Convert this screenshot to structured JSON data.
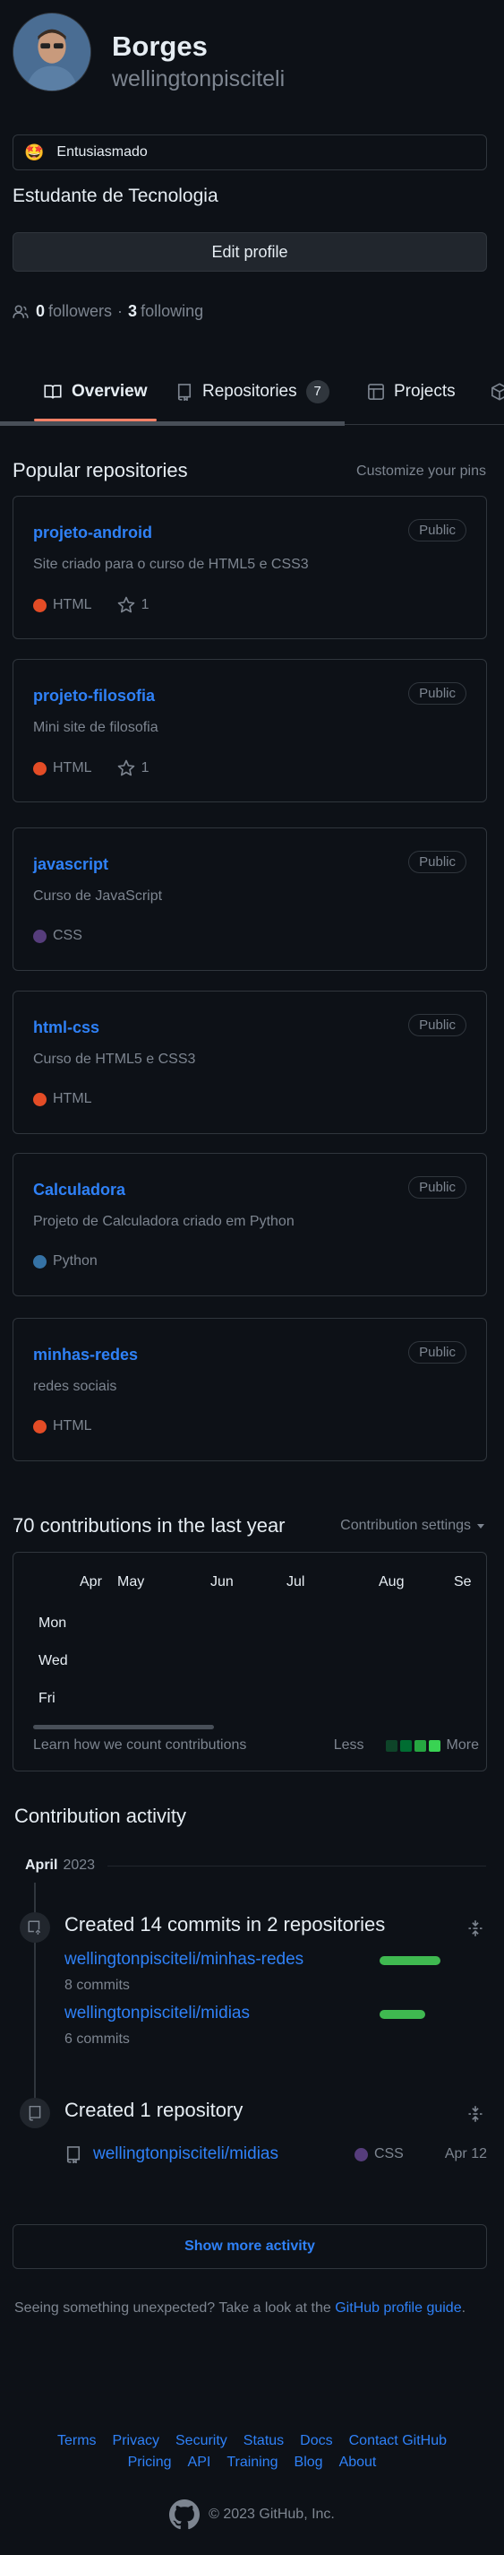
{
  "profile": {
    "name": "Borges",
    "login": "wellingtonpisciteli",
    "status_emoji": "🤩",
    "status_text": "Entusiasmado",
    "bio": "Estudante de Tecnologia",
    "edit_label": "Edit profile",
    "followers_count": "0",
    "followers_label": "followers",
    "separator": "·",
    "following_count": "3",
    "following_label": "following"
  },
  "tabs": {
    "overview": "Overview",
    "repositories": "Repositories",
    "repositories_count": "7",
    "projects": "Projects"
  },
  "pinned": {
    "title": "Popular repositories",
    "customize": "Customize your pins",
    "repos": [
      {
        "name": "projeto-android",
        "visibility": "Public",
        "description": "Site criado para o curso de HTML5 e CSS3",
        "language": "HTML",
        "language_color": "#e34c26",
        "stars": "1"
      },
      {
        "name": "projeto-filosofia",
        "visibility": "Public",
        "description": "Mini site de filosofia",
        "language": "HTML",
        "language_color": "#e34c26",
        "stars": "1"
      },
      {
        "name": "javascript",
        "visibility": "Public",
        "description": "Curso de JavaScript",
        "language": "CSS",
        "language_color": "#563d7c",
        "stars": ""
      },
      {
        "name": "html-css",
        "visibility": "Public",
        "description": "Curso de HTML5 e CSS3",
        "language": "HTML",
        "language_color": "#e34c26",
        "stars": ""
      },
      {
        "name": "Calculadora",
        "visibility": "Public",
        "description": "Projeto de Calculadora criado em Python",
        "language": "Python",
        "language_color": "#3572A5",
        "stars": ""
      },
      {
        "name": "minhas-redes",
        "visibility": "Public",
        "description": "redes sociais",
        "language": "HTML",
        "language_color": "#e34c26",
        "stars": ""
      }
    ]
  },
  "contributions": {
    "title": "70 contributions in the last year",
    "settings": "Contribution settings",
    "months": [
      "Apr",
      "May",
      "Jun",
      "Jul",
      "Aug",
      "Se"
    ],
    "days": [
      "Mon",
      "Wed",
      "Fri"
    ],
    "learn": "Learn how we count contributions",
    "less": "Less",
    "more": "More",
    "legend_colors": [
      "#0e4429",
      "#006d32",
      "#26a641",
      "#39d353"
    ]
  },
  "activity": {
    "title": "Contribution activity",
    "month": "April",
    "year": "2023",
    "commits_title": "Created 14 commits in 2 repositories",
    "commit_repos": [
      {
        "name": "wellingtonpisciteli/minhas-redes",
        "count": "8 commits",
        "share": 0.57
      },
      {
        "name": "wellingtonpisciteli/midias",
        "count": "6 commits",
        "share": 0.43
      }
    ],
    "repo_title": "Created 1 repository",
    "created_repo": {
      "name": "wellingtonpisciteli/midias",
      "language": "CSS",
      "language_color": "#563d7c",
      "date": "Apr 12"
    },
    "show_more": "Show more activity",
    "unexpected_text": "Seeing something unexpected? Take a look at the",
    "guide_link": "GitHub profile guide",
    "period": "."
  },
  "footer": {
    "links_row1": [
      "Terms",
      "Privacy",
      "Security",
      "Status",
      "Docs",
      "Contact GitHub"
    ],
    "links_row2": [
      "Pricing",
      "API",
      "Training",
      "Blog",
      "About"
    ],
    "copyright": "© 2023 GitHub, Inc."
  }
}
